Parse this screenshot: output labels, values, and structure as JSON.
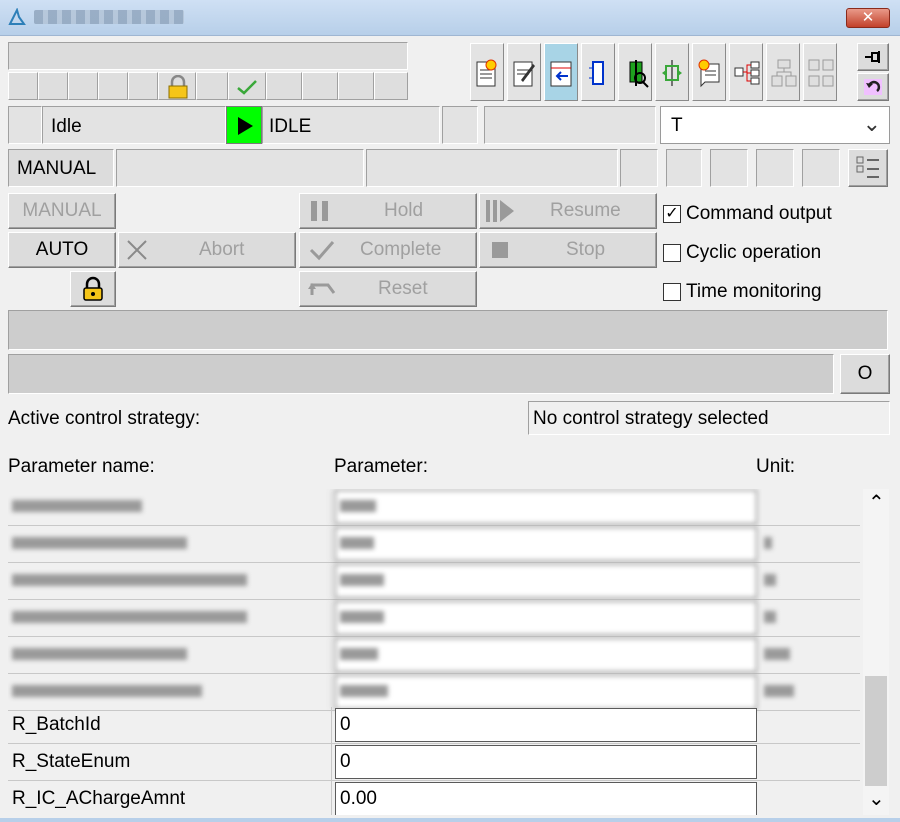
{
  "window": {
    "close_glyph": "✕",
    "app_icon": "triangle-logo-icon"
  },
  "state": {
    "mode": "Idle",
    "state_code": "IDLE",
    "dropdown_value": "T",
    "play_color": "#00ff00"
  },
  "mode_box": {
    "label": "MANUAL"
  },
  "buttons": {
    "manual": "MANUAL",
    "auto": "AUTO",
    "abort": "Abort",
    "hold": "Hold",
    "resume": "Resume",
    "complete": "Complete",
    "stop": "Stop",
    "reset": "Reset",
    "o": "O"
  },
  "options": [
    {
      "label": "Command output",
      "checked": true,
      "check_glyph": "✓"
    },
    {
      "label": "Cyclic operation",
      "checked": false,
      "check_glyph": ""
    },
    {
      "label": "Time monitoring",
      "checked": false,
      "check_glyph": ""
    }
  ],
  "strategy": {
    "label": "Active control strategy:",
    "value": "No control strategy selected"
  },
  "table": {
    "headers": {
      "name": "Parameter name:",
      "value": "Parameter:",
      "unit": "Unit:"
    },
    "rows": [
      {
        "name": "",
        "value": "",
        "unit": ""
      },
      {
        "name": "",
        "value": "",
        "unit": ""
      },
      {
        "name": "",
        "value": "",
        "unit": ""
      },
      {
        "name": "",
        "value": "",
        "unit": ""
      },
      {
        "name": "",
        "value": "",
        "unit": ""
      },
      {
        "name": "",
        "value": "",
        "unit": ""
      },
      {
        "name": "R_BatchId",
        "value": "0",
        "unit": ""
      },
      {
        "name": "R_StateEnum",
        "value": "0",
        "unit": ""
      },
      {
        "name": "R_IC_AChargeAmnt",
        "value": "0.00",
        "unit": ""
      }
    ],
    "scroll_up": "⌃",
    "scroll_down": "⌄"
  },
  "dropdown_arrow": "⌄"
}
